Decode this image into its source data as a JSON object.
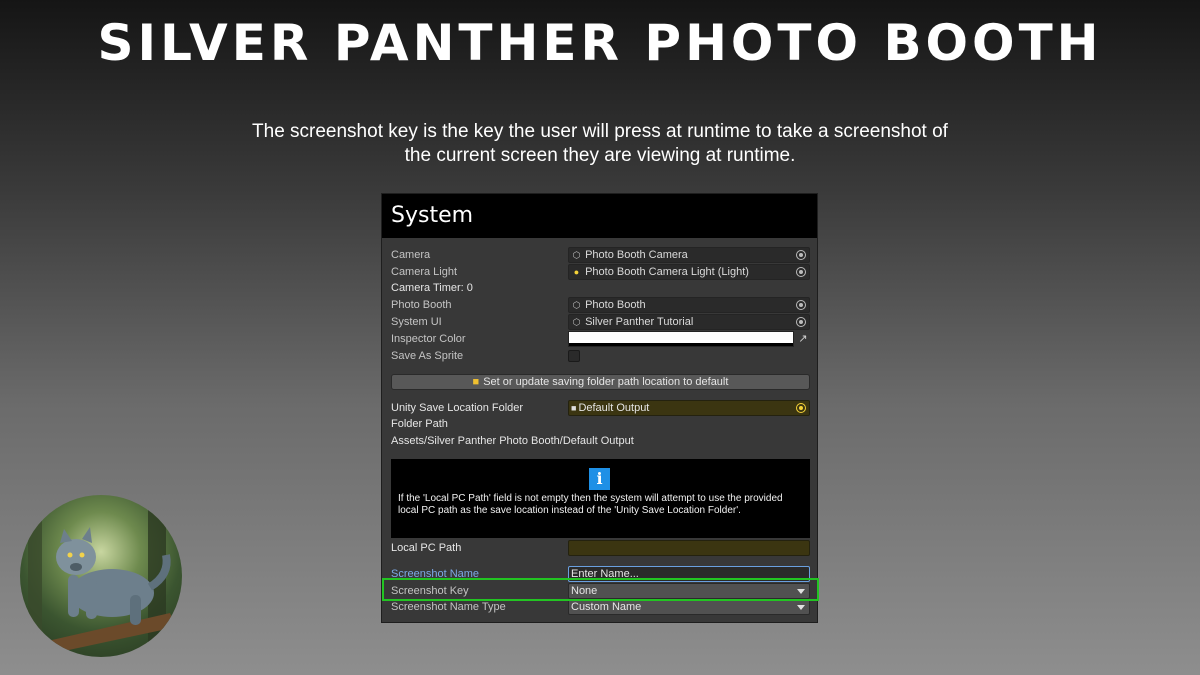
{
  "banner": {
    "title": "SILVER PANTHER PHOTO BOOTH",
    "description": "The screenshot key is the key the user will press at runtime to take a screenshot of the current screen they are viewing at runtime."
  },
  "inspector": {
    "header": "System",
    "camera": {
      "label": "Camera",
      "value": "Photo Booth Camera",
      "icon": "gameobject-icon"
    },
    "camera_light": {
      "label": "Camera Light",
      "value": "Photo Booth Camera Light (Light)",
      "icon": "light-bulb-icon"
    },
    "camera_timer": {
      "label": "Camera Timer: 0"
    },
    "photo_booth": {
      "label": "Photo Booth",
      "value": "Photo Booth",
      "icon": "gameobject-icon"
    },
    "system_ui": {
      "label": "System UI",
      "value": "Silver Panther Tutorial",
      "icon": "gameobject-icon"
    },
    "inspector_color": {
      "label": "Inspector Color",
      "color": "#ffffff"
    },
    "save_as_sprite": {
      "label": "Save As Sprite",
      "checked": false
    },
    "default_path_button": {
      "label": "Set or update saving folder path location to default",
      "icon": "folder-icon"
    },
    "unity_save_location": {
      "label": "Unity Save Location Folder",
      "value": "Default Output",
      "icon": "folder-icon"
    },
    "folder_path": {
      "label": "Folder Path",
      "value": "Assets/Silver Panther Photo Booth/Default Output"
    },
    "info": {
      "icon": "info-icon",
      "text": "If the 'Local PC Path' field is not empty then the system will attempt to use the provided local PC path as the save location instead of the 'Unity Save Location Folder'."
    },
    "local_pc_path": {
      "label": "Local PC Path",
      "value": ""
    },
    "screenshot_name": {
      "label": "Screenshot Name",
      "value": "Enter Name..."
    },
    "screenshot_key": {
      "label": "Screenshot Key",
      "value": "None"
    },
    "screenshot_name_type": {
      "label": "Screenshot Name Type",
      "value": "Custom Name"
    }
  },
  "colors": {
    "highlight": "#22c422",
    "info_icon": "#1e90e6",
    "link_label": "#7ca9e6"
  },
  "avatar": {
    "subject": "panther-image"
  }
}
